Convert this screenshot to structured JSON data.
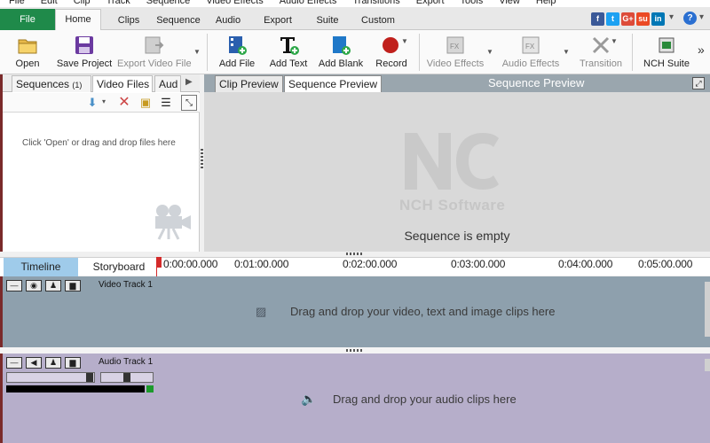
{
  "menu": [
    "File",
    "Edit",
    "Clip",
    "Track",
    "Sequence",
    "Video Effects",
    "Audio Effects",
    "Transitions",
    "Export",
    "Tools",
    "View",
    "Help"
  ],
  "ribbon": {
    "file_label": "File",
    "tabs": [
      "Home",
      "Clips",
      "Sequence",
      "Audio",
      "Export",
      "Suite",
      "Custom"
    ],
    "active_tab": "Home",
    "social": [
      {
        "name": "facebook-icon",
        "glyph": "f",
        "color": "#3b5998"
      },
      {
        "name": "twitter-icon",
        "glyph": "t",
        "color": "#1da1f2"
      },
      {
        "name": "googleplus-icon",
        "glyph": "G+",
        "color": "#dd4b39"
      },
      {
        "name": "stumbleupon-icon",
        "glyph": "su",
        "color": "#eb4924"
      },
      {
        "name": "linkedin-icon",
        "glyph": "in",
        "color": "#0077b5"
      }
    ],
    "help_glyph": "?"
  },
  "toolbar": {
    "open": "Open",
    "save_project": "Save Project",
    "export_video": "Export Video File",
    "add_file": "Add File",
    "add_text": "Add Text",
    "add_blank": "Add Blank",
    "record": "Record",
    "video_effects": "Video Effects",
    "audio_effects": "Audio Effects",
    "transition": "Transition",
    "nch_suite": "NCH Suite"
  },
  "left_panel": {
    "tabs": [
      {
        "label": "Sequences",
        "badge": "(1)"
      },
      {
        "label": "Video Files"
      },
      {
        "label": "Aud"
      }
    ],
    "active_tab": "Video Files",
    "empty_message": "Click 'Open' or drag and drop files here"
  },
  "preview": {
    "tabs": [
      "Clip Preview",
      "Sequence Preview"
    ],
    "active_tab": "Sequence Preview",
    "title": "Sequence Preview",
    "logo_text": "NCH Software",
    "status": "Sequence is empty"
  },
  "timeline": {
    "tabs": [
      "Timeline",
      "Storyboard"
    ],
    "active_tab": "Timeline",
    "ticks": [
      "0:00:00.000",
      "0:01:00.000",
      "0:02:00.000",
      "0:03:00.000",
      "0:04:00.000",
      "0:05:00.000"
    ],
    "video_track": {
      "label": "Video Track 1",
      "drop_message": "Drag and drop your video, text and image clips here"
    },
    "audio_track": {
      "label": "Audio Track 1",
      "drop_message": "Drag and drop your audio clips here"
    }
  },
  "colors": {
    "accent_green": "#1f8a4a",
    "video_track": "#8ea0ad",
    "audio_track": "#b6aeca",
    "playhead": "#d42a2a",
    "timeline_tab": "#9fcbea"
  }
}
